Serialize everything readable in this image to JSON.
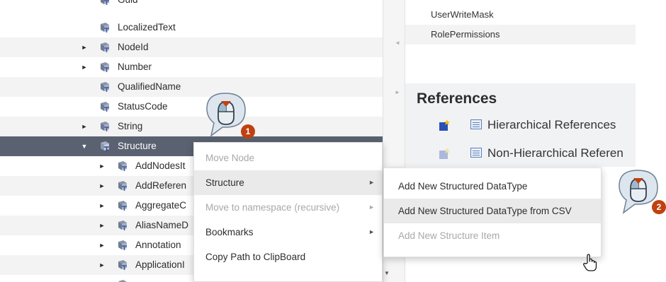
{
  "tree": {
    "items": [
      {
        "label": "Guid",
        "arrow": ""
      },
      {
        "label": "LocalizedText",
        "arrow": ""
      },
      {
        "label": "NodeId",
        "arrow": "►"
      },
      {
        "label": "Number",
        "arrow": "►"
      },
      {
        "label": "QualifiedName",
        "arrow": ""
      },
      {
        "label": "StatusCode",
        "arrow": ""
      },
      {
        "label": "String",
        "arrow": "►"
      },
      {
        "label": "Structure",
        "arrow": "▼"
      },
      {
        "label": "AddNodesIt",
        "arrow": "►"
      },
      {
        "label": "AddReferen",
        "arrow": "►"
      },
      {
        "label": "AggregateC",
        "arrow": "►"
      },
      {
        "label": "AliasNameD",
        "arrow": "►"
      },
      {
        "label": "Annotation",
        "arrow": "►"
      },
      {
        "label": "ApplicationI",
        "arrow": "►"
      }
    ]
  },
  "properties": {
    "rows": [
      {
        "label": "UserWriteMask"
      },
      {
        "label": "RolePermissions"
      }
    ]
  },
  "references": {
    "title": "References",
    "items": [
      {
        "label": "Hierarchical References"
      },
      {
        "label": "Non-Hierarchical Referen"
      }
    ]
  },
  "context_menu": {
    "items": [
      {
        "label": "Move Node",
        "disabled": true,
        "submenu_arrow": ""
      },
      {
        "label": "Structure",
        "disabled": false,
        "submenu_arrow": "►"
      },
      {
        "label": "Move to namespace (recursive)",
        "disabled": true,
        "submenu_arrow": "►"
      },
      {
        "label": "Bookmarks",
        "disabled": false,
        "submenu_arrow": "►"
      },
      {
        "label": "Copy Path to ClipBoard",
        "disabled": false,
        "submenu_arrow": ""
      }
    ]
  },
  "submenu": {
    "items": [
      {
        "label": "Add New Structured DataType",
        "disabled": false
      },
      {
        "label": "Add New Structured DataType from CSV",
        "disabled": false
      },
      {
        "label": "Add New Structure Item",
        "disabled": true
      }
    ]
  },
  "callouts": {
    "first": "1",
    "second": "2"
  },
  "splitter": {
    "left_grip": "◄",
    "right_grip": "►"
  },
  "colors": {
    "selected_row": "#5a6170",
    "callout_badge": "#c0410f",
    "callout_bubble": "#dde6ee"
  },
  "icons": {
    "tree_node": "datatype-node-icon",
    "reference_add": "add-reference-icon",
    "reference_list": "list-icon",
    "mouse": "mouse-click-icon",
    "cursor": "hand-cursor-icon"
  }
}
